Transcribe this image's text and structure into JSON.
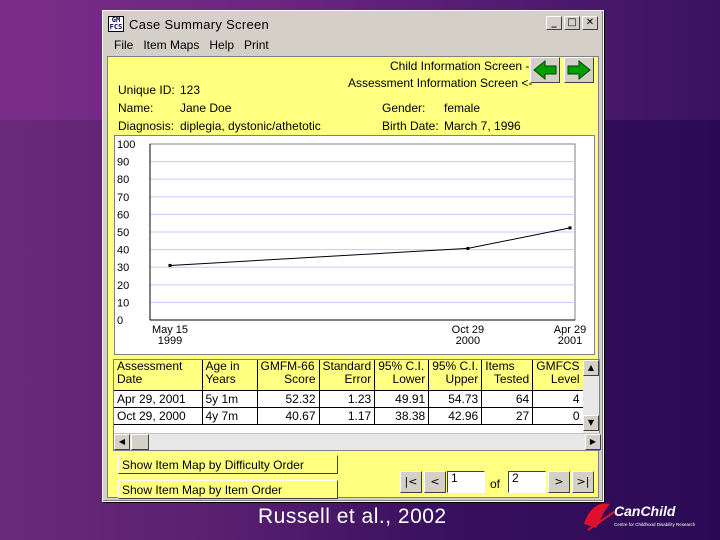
{
  "window": {
    "title": "Case Summary Screen",
    "icon_text": "GM FCS",
    "controls": [
      "_",
      "□",
      "✕"
    ]
  },
  "menu": [
    "File",
    "Item Maps",
    "Help",
    "Print"
  ],
  "nav": {
    "child_info": "Child Information Screen ->",
    "assessment_info": "Assessment Information Screen <-"
  },
  "patient": {
    "unique_id_label": "Unique ID:",
    "unique_id": "123",
    "name_label": "Name:",
    "name": "Jane Doe",
    "diagnosis_label": "Diagnosis:",
    "diagnosis": "diplegia, dystonic/athetotic",
    "gender_label": "Gender:",
    "gender": "female",
    "birth_label": "Birth Date:",
    "birth_date": "March 7, 1996"
  },
  "chart_data": {
    "type": "line",
    "yticks": [
      "100",
      "90",
      "80",
      "70",
      "60",
      "50",
      "40",
      "30",
      "20",
      "10",
      "0"
    ],
    "ylim": [
      0,
      100
    ],
    "xticks": [
      {
        "line1": "May 15",
        "line2": "1999",
        "t": 0
      },
      {
        "line1": "Oct 29",
        "line2": "2000",
        "t": 17.5
      },
      {
        "line1": "Apr 29",
        "line2": "2001",
        "t": 23.5
      }
    ],
    "x": [
      0,
      17.5,
      23.5
    ],
    "values": [
      31,
      40.67,
      52.32
    ],
    "line_color": "#000000"
  },
  "table": {
    "headers": [
      [
        "Assessment",
        "Date"
      ],
      [
        "Age in",
        "Years"
      ],
      [
        "GMFM-66",
        "Score"
      ],
      [
        "Standard",
        "Error"
      ],
      [
        "95% C.I.",
        "Lower"
      ],
      [
        "95% C.I.",
        "Upper"
      ],
      [
        "Items",
        "Tested"
      ],
      [
        "GMFCS",
        "Level"
      ]
    ],
    "rows": [
      [
        "Apr 29, 2001",
        "5y  1m",
        "52.32",
        "1.23",
        "49.91",
        "54.73",
        "64",
        "4"
      ],
      [
        "Oct 29, 2000",
        "4y  7m",
        "40.67",
        "1.17",
        "38.38",
        "42.96",
        "27",
        "0"
      ]
    ]
  },
  "buttons": {
    "difficulty": "Show Item Map by Difficulty Order",
    "item_order": "Show Item Map by Item Order"
  },
  "pager": {
    "first": "|<",
    "prev": "<",
    "current": "1",
    "of": "of",
    "total": "2",
    "next": ">",
    "last": ">|"
  },
  "caption": "Russell et al., 2002",
  "logo": {
    "name": "CanChild",
    "tagline": "Centre for Childhood Disability Research"
  },
  "colors": {
    "panel": "#ffff80",
    "arrow_green": "#00a000"
  }
}
